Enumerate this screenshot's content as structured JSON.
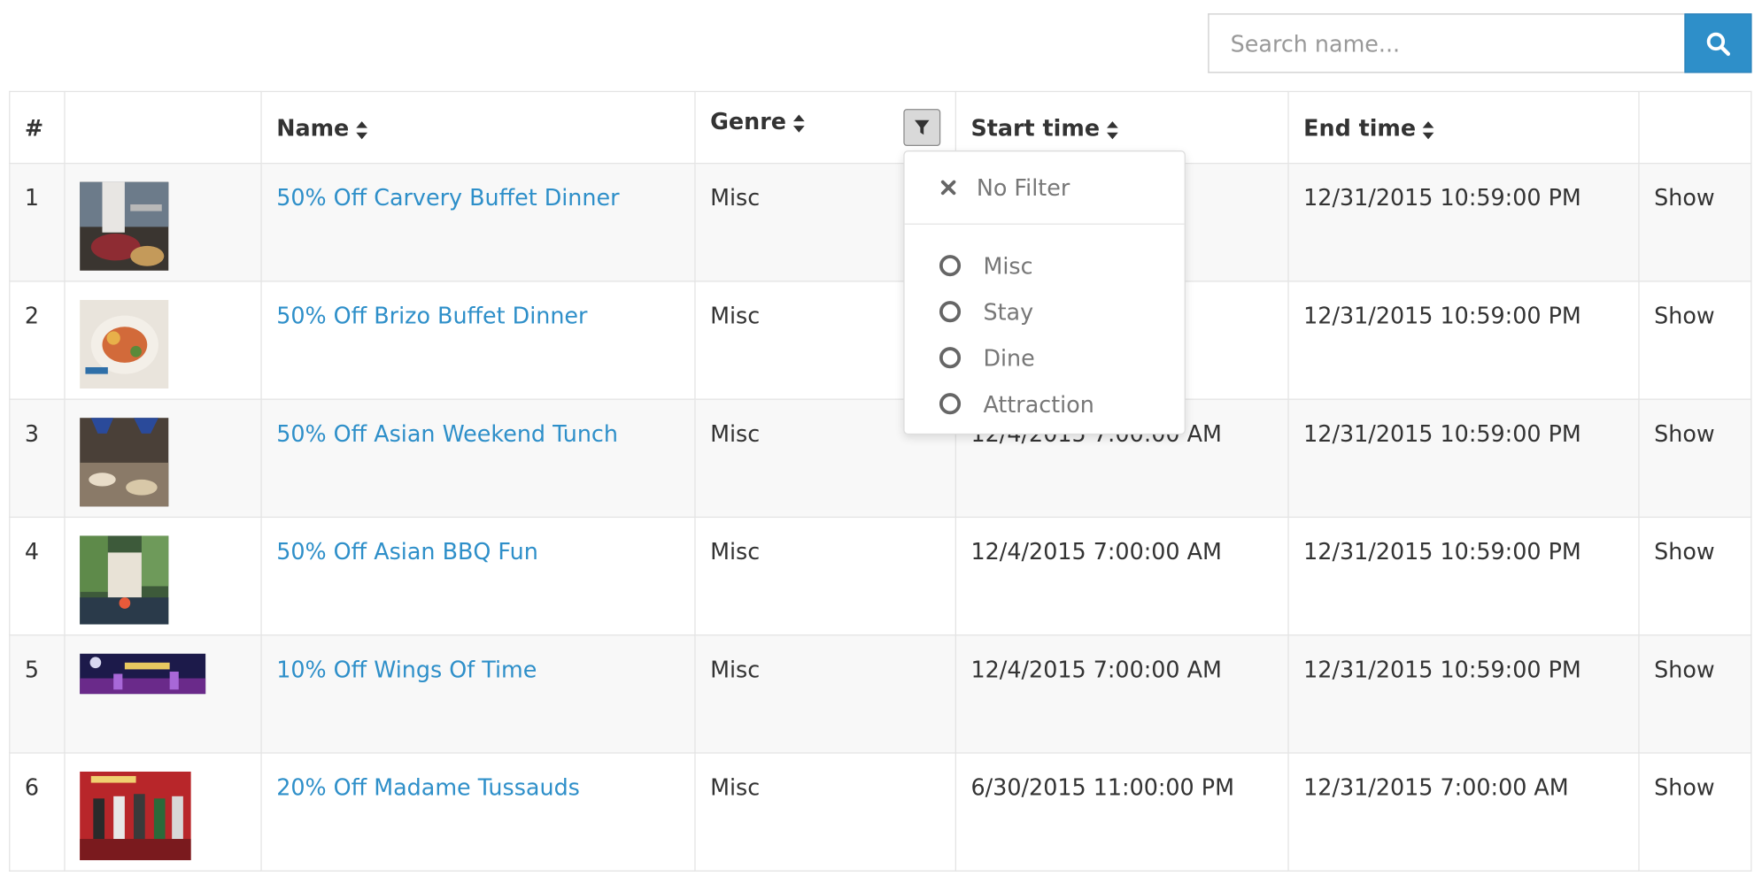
{
  "search": {
    "placeholder": "Search name..."
  },
  "table": {
    "headers": {
      "index": "#",
      "image": "",
      "name": "Name",
      "genre": "Genre",
      "start": "Start time",
      "end": "End time",
      "action": ""
    },
    "rows": [
      {
        "index": "1",
        "image": "carvery-buffet-thumbnail",
        "name": "50% Off Carvery Buffet Dinner",
        "genre": "Misc",
        "start": "",
        "end": "12/31/2015 10:59:00 PM",
        "action": "Show"
      },
      {
        "index": "2",
        "image": "brizo-buffet-thumbnail",
        "name": "50% Off Brizo Buffet Dinner",
        "genre": "Misc",
        "start": "",
        "end": "12/31/2015 10:59:00 PM",
        "action": "Show"
      },
      {
        "index": "3",
        "image": "asian-weekend-thumbnail",
        "name": "50% Off Asian Weekend Tunch",
        "genre": "Misc",
        "start": "12/4/2015 7:00:00 AM",
        "end": "12/31/2015 10:59:00 PM",
        "action": "Show"
      },
      {
        "index": "4",
        "image": "asian-bbq-thumbnail",
        "name": "50% Off Asian BBQ Fun",
        "genre": "Misc",
        "start": "12/4/2015 7:00:00 AM",
        "end": "12/31/2015 10:59:00 PM",
        "action": "Show"
      },
      {
        "index": "5",
        "image": "wings-of-time-banner",
        "name": "10% Off Wings Of Time",
        "genre": "Misc",
        "start": "12/4/2015 7:00:00 AM",
        "end": "12/31/2015 10:59:00 PM",
        "action": "Show"
      },
      {
        "index": "6",
        "image": "madame-tussauds-thumbnail",
        "name": "20% Off Madame Tussauds",
        "genre": "Misc",
        "start": "6/30/2015 11:00:00 PM",
        "end": "12/31/2015 7:00:00 AM",
        "action": "Show"
      }
    ]
  },
  "genre_filter": {
    "no_filter_label": "No Filter",
    "options": [
      "Misc",
      "Stay",
      "Dine",
      "Attraction"
    ]
  },
  "colors": {
    "accent": "#2e8fc9",
    "link": "#2e8fc9",
    "stripe": "#f8f8f8",
    "border": "#e3e3e3"
  },
  "icons": {
    "search": "search-icon",
    "sort": "sort-icon",
    "filter": "filter-icon",
    "close": "close-icon"
  }
}
